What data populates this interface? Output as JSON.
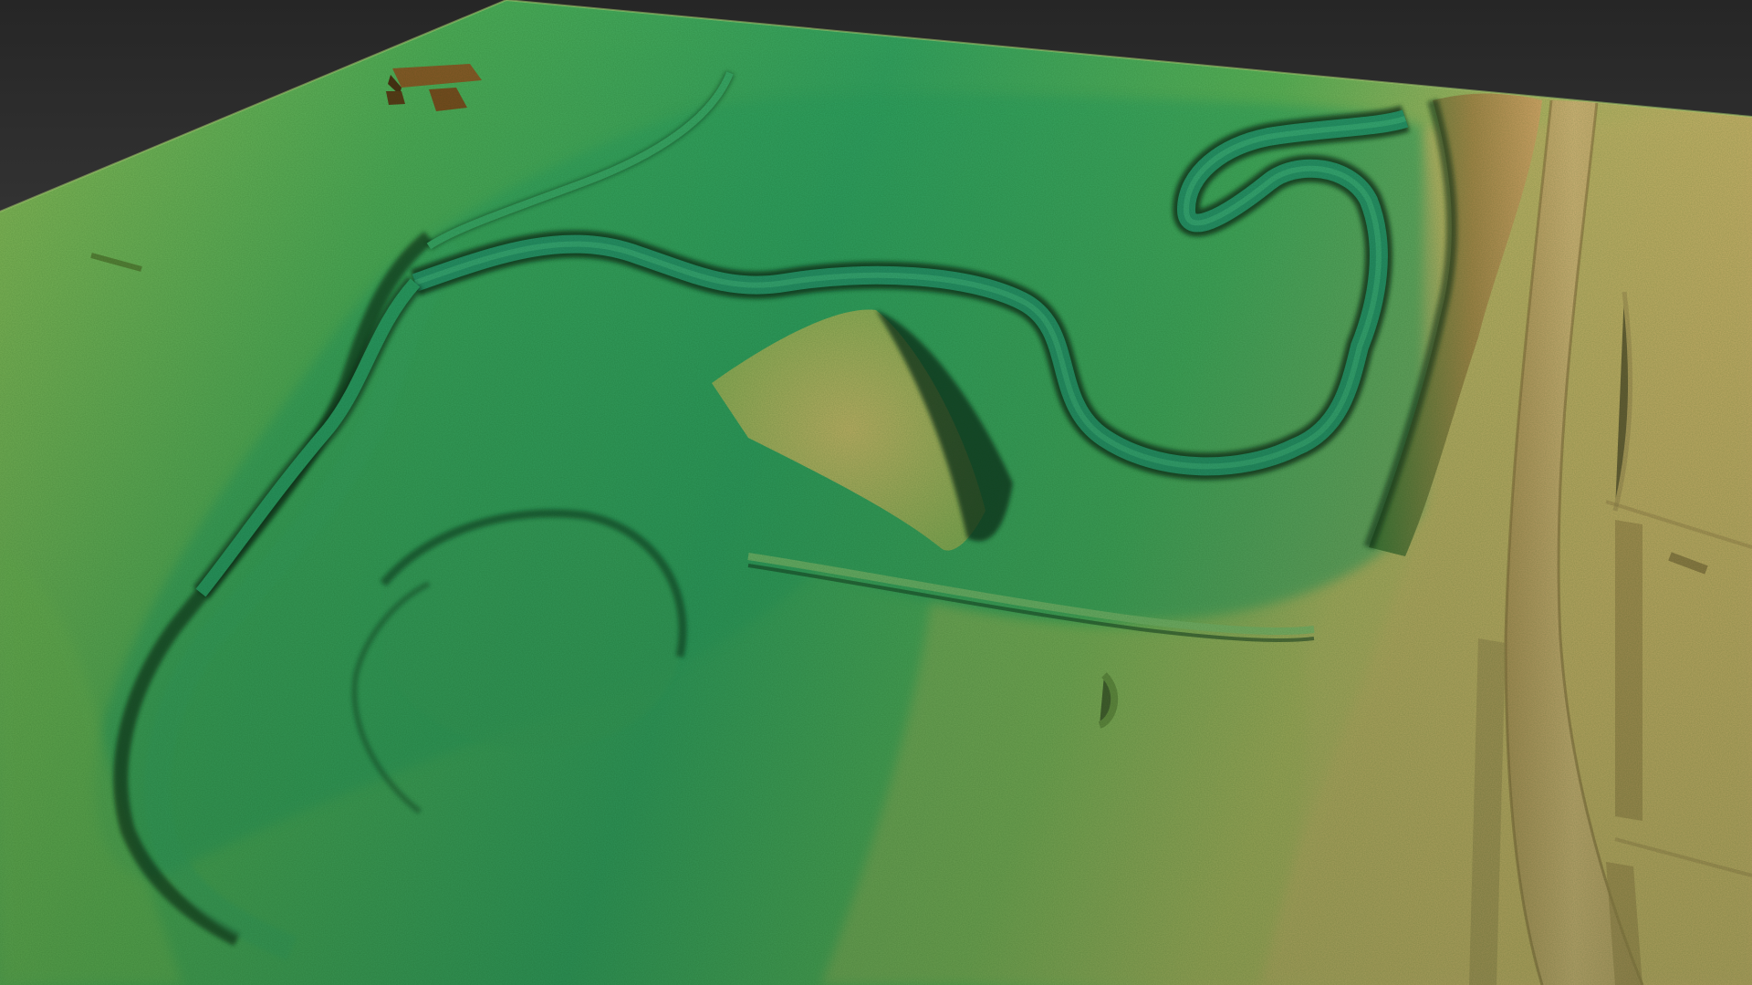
{
  "scene": {
    "kind": "3d-lidar-terrain-model",
    "colors": {
      "background_top": "#2a2a2a",
      "background_bottom": "#5e5e5e",
      "low_elevation": "#2f9a5c",
      "mid_elevation": "#6cb552",
      "high_elevation": "#c9b567",
      "river_channel": "#1f7a4c",
      "road": "#cfae72",
      "shadow": "#0e2a18"
    },
    "features": [
      "river-meander",
      "oxbow-channel",
      "floodplain",
      "embankment-ridge",
      "road",
      "field-drains",
      "farm-buildings"
    ]
  }
}
